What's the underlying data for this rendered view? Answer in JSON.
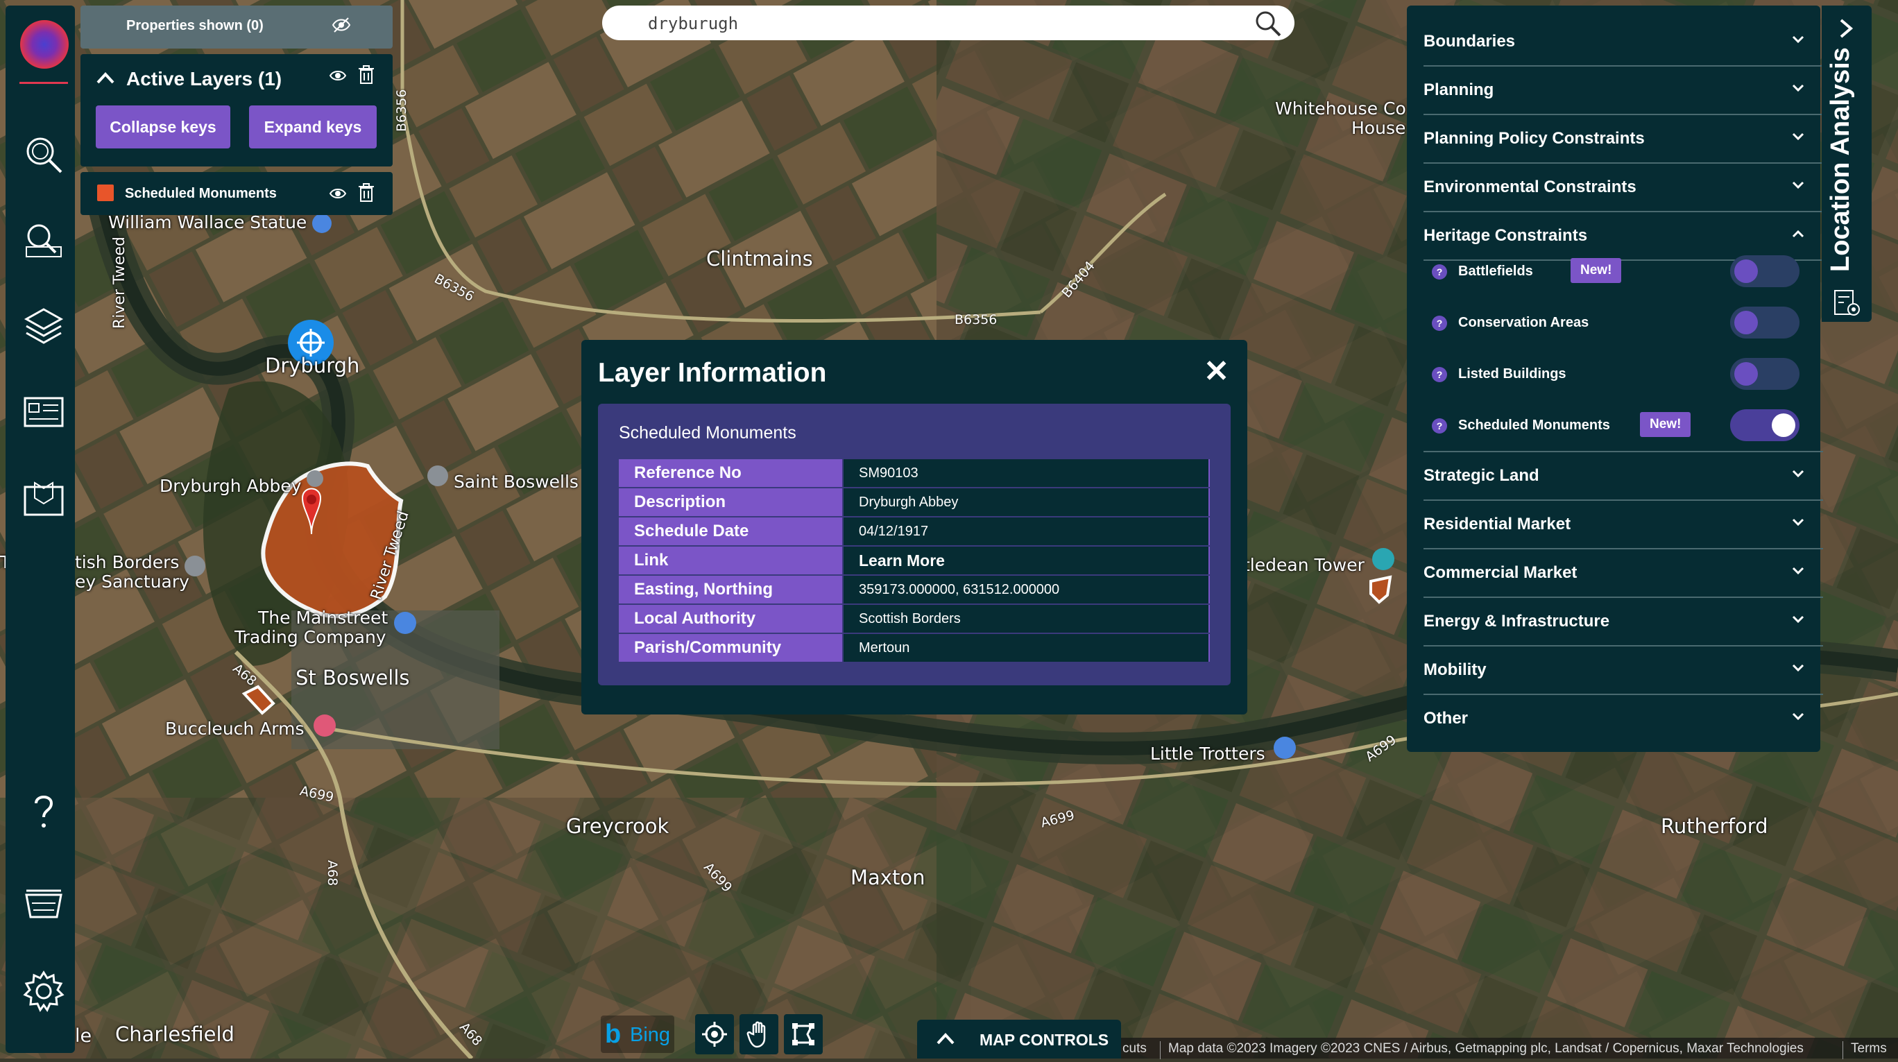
{
  "search": {
    "value": "dryburugh"
  },
  "layers_panel": {
    "properties_label": "Properties shown (0)",
    "active_layers_title": "Active Layers (1)",
    "collapse_label": "Collapse keys",
    "expand_label": "Expand keys",
    "layer_name": "Scheduled Monuments",
    "layer_color": "#e8552a"
  },
  "dialog": {
    "title": "Layer Information",
    "close_glyph": "✕",
    "subtitle": "Scheduled Monuments",
    "rows": [
      {
        "key": "Reference No",
        "value": "SM90103"
      },
      {
        "key": "Description",
        "value": "Dryburgh Abbey"
      },
      {
        "key": "Schedule Date",
        "value": "04/12/1917"
      },
      {
        "key": "Link",
        "value": "Learn More"
      },
      {
        "key": "Easting, Northing",
        "value": "359173.000000, 631512.000000"
      },
      {
        "key": "Local Authority",
        "value": "Scottish Borders"
      },
      {
        "key": "Parish/Community",
        "value": "Mertoun"
      }
    ]
  },
  "right_panel": {
    "categories_top": [
      "Boundaries",
      "Planning",
      "Planning Policy Constraints",
      "Environmental Constraints",
      "Heritage Constraints"
    ],
    "heritage_items": [
      {
        "label": "Battlefields",
        "new": "New!",
        "on": false
      },
      {
        "label": "Conservation Areas",
        "new": "",
        "on": false
      },
      {
        "label": "Listed Buildings",
        "new": "",
        "on": false
      },
      {
        "label": "Scheduled Monuments",
        "new": "New!",
        "on": true
      }
    ],
    "categories_bottom": [
      "Strategic Land",
      "Residential Market",
      "Commercial Market",
      "Energy & Infrastructure",
      "Mobility",
      "Other"
    ],
    "help_glyph": "?"
  },
  "location_tab": {
    "label": "Location Analysis"
  },
  "map": {
    "labels": {
      "william_wallace": "William Wallace Statue",
      "river_tweed_1": "River Tweed",
      "river_tweed_2": "River Tweed",
      "dryburgh": "Dryburgh",
      "dryburgh_abbey": "Dryburgh Abbey",
      "saint_boswells": "Saint Boswells",
      "borders_1": "tish Borders",
      "borders_2": "ey Sanctuary",
      "mainstreet_1": "The Mainstreet",
      "mainstreet_2": "Trading Company",
      "st_boswells": "St Boswells",
      "buccleuch": "Buccleuch Arms",
      "charlesfield": "Charlesfield",
      "clintmains": "Clintmains",
      "whitehouse_1": "Whitehouse Co",
      "whitehouse_2": "House",
      "lessudden": "tledean Tower",
      "little_trotters": "Little Trotters",
      "greycrook": "Greycrook",
      "maxton": "Maxton",
      "rutherford": "Rutherford",
      "edge_le": "le",
      "edge_t": "T"
    },
    "roads": {
      "b6356_a": "B6356",
      "b6356_b": "B6356",
      "b6356_c": "B6356",
      "b6404": "B6404",
      "a68_a": "A68",
      "a68_b": "A68",
      "a68_c": "A68",
      "a699_a": "A699",
      "a699_b": "A699",
      "a699_c": "A699",
      "a699_d": "A699"
    }
  },
  "bottom": {
    "bing_b": "b",
    "bing_text": "Bing",
    "map_controls": "MAP CONTROLS",
    "shortcuts": "cuts",
    "attribution": "Map data ©2023 Imagery ©2023 CNES / Airbus, Getmapping plc, Landsat / Copernicus, Maxar Technologies",
    "terms": "Terms"
  },
  "colors": {
    "panel": "#062c33",
    "accent": "#7b55c7",
    "monument": "#b5501f"
  }
}
